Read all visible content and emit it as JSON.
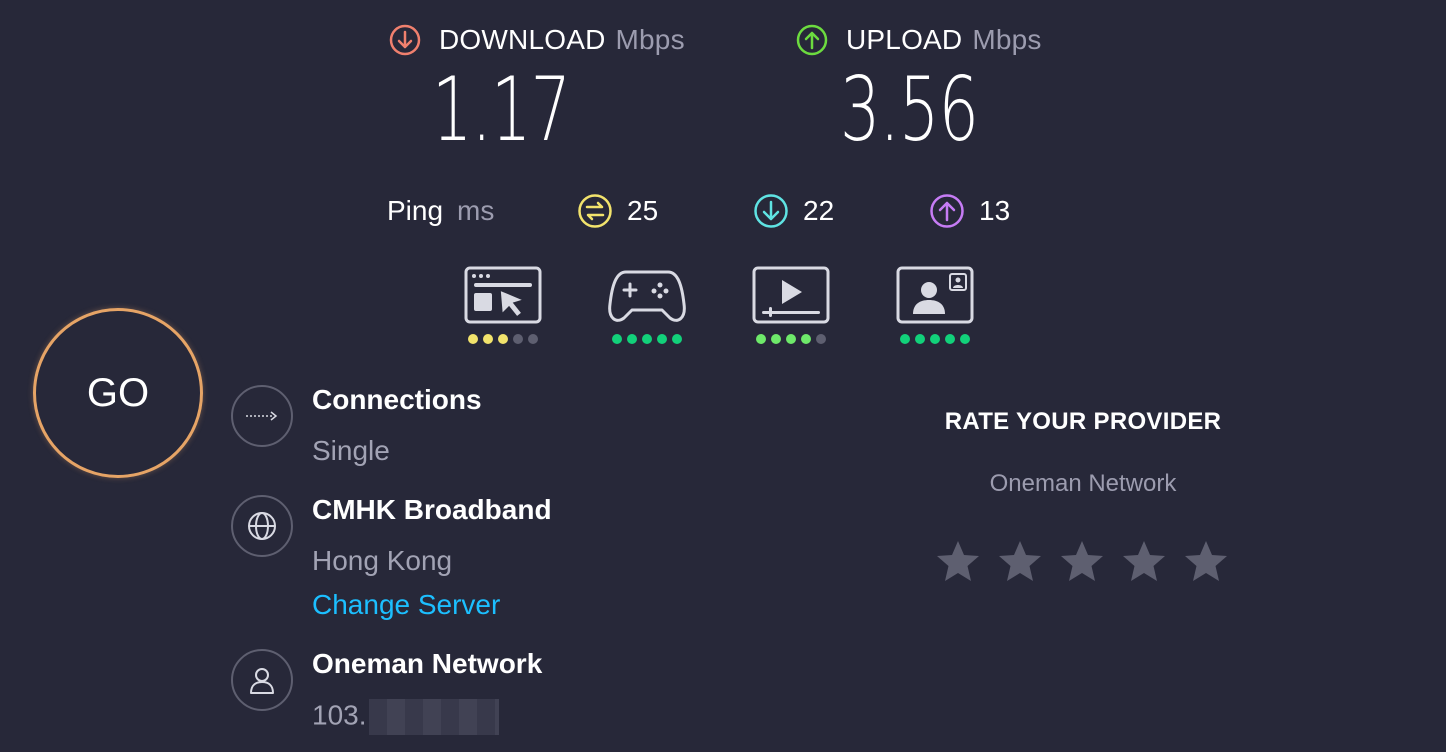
{
  "download": {
    "label": "DOWNLOAD",
    "unit": "Mbps",
    "value": "1.17",
    "icon": "arrow-down-circle-icon",
    "color": "#f0806e"
  },
  "upload": {
    "label": "UPLOAD",
    "unit": "Mbps",
    "value": "3.56",
    "icon": "arrow-up-circle-icon",
    "color": "#6cdb3f"
  },
  "ping": {
    "label": "Ping",
    "unit": "ms",
    "idle": {
      "value": "25",
      "icon": "ping-idle-icon",
      "color": "#f2e36c"
    },
    "download": {
      "value": "22",
      "icon": "ping-download-icon",
      "color": "#5fe3e3"
    },
    "upload": {
      "value": "13",
      "icon": "ping-upload-icon",
      "color": "#c67cf5"
    }
  },
  "quality": [
    {
      "name": "web-browsing-icon",
      "rating": 3,
      "of": 5,
      "color": "#f2e36c"
    },
    {
      "name": "gaming-icon",
      "rating": 5,
      "of": 5,
      "color": "#12d17a"
    },
    {
      "name": "video-streaming-icon",
      "rating": 4,
      "of": 5,
      "color": "#6ee96a"
    },
    {
      "name": "video-chat-icon",
      "rating": 5,
      "of": 5,
      "color": "#12d17a"
    }
  ],
  "go_label": "GO",
  "connections": {
    "title": "Connections",
    "value": "Single",
    "icon": "connections-arrow-icon"
  },
  "server": {
    "title": "CMHK Broadband",
    "location": "Hong Kong",
    "change_link": "Change Server",
    "icon": "globe-icon"
  },
  "provider": {
    "title": "Oneman Network",
    "ip_visible": "103.",
    "icon": "user-icon"
  },
  "rate": {
    "title": "RATE YOUR PROVIDER",
    "provider": "Oneman Network",
    "stars": 5
  },
  "colors": {
    "background": "#272839",
    "accent_link": "#1cbfff",
    "go_ring": "#e6a466"
  }
}
